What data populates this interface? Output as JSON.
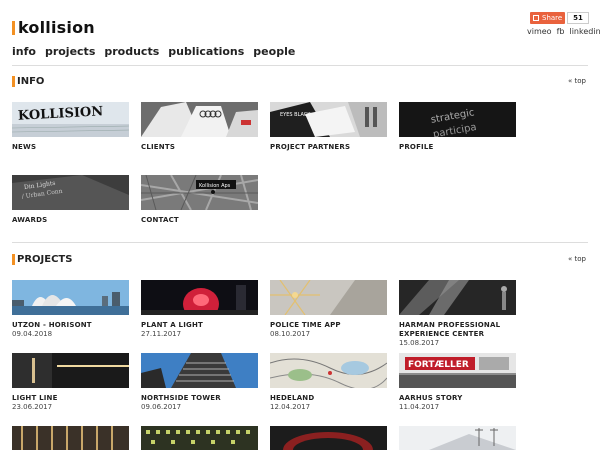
{
  "brand": {
    "name": "kollision",
    "accent": "#f39123"
  },
  "share": {
    "label": "Share",
    "count": "51",
    "color": "#e9623d"
  },
  "social": [
    "vimeo",
    "fb",
    "linkedin"
  ],
  "nav": [
    "info",
    "projects",
    "products",
    "publications",
    "people"
  ],
  "info": {
    "title": "INFO",
    "top_link": "« top",
    "tiles": [
      {
        "label": "NEWS",
        "image_text": "KOLLISION"
      },
      {
        "label": "CLIENTS"
      },
      {
        "label": "PROJECT PARTNERS",
        "image_text": "EYES BLACK"
      },
      {
        "label": "PROFILE",
        "image_text": [
          "strategic",
          "participa"
        ]
      },
      {
        "label": "AWARDS",
        "image_text": [
          "Din Lights",
          "/ Urban Conn"
        ]
      },
      {
        "label": "CONTACT",
        "image_text": "Kollision Aps"
      }
    ]
  },
  "projects": {
    "title": "PROJECTS",
    "top_link": "« top",
    "tiles": [
      {
        "label": "UTZON - HORISONT",
        "date": "09.04.2018"
      },
      {
        "label": "PLANT A LIGHT",
        "date": "27.11.2017"
      },
      {
        "label": "POLICE TIME APP",
        "date": "08.10.2017"
      },
      {
        "label": "HARMAN PROFESSIONAL",
        "label2": "EXPERIENCE CENTER",
        "date": "15.08.2017"
      },
      {
        "label": "LIGHT LINE",
        "date": "23.06.2017"
      },
      {
        "label": "NORTHSIDE TOWER",
        "date": "09.06.2017"
      },
      {
        "label": "HEDELAND",
        "date": "12.04.2017"
      },
      {
        "label": "AARHUS STORY",
        "date": "11.04.2017",
        "image_text": "FORTÆLLER"
      },
      {
        "label": ""
      },
      {
        "label": ""
      },
      {
        "label": ""
      },
      {
        "label": ""
      }
    ]
  }
}
